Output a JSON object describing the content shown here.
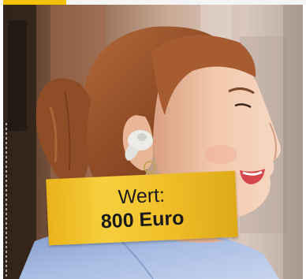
{
  "badge": {
    "label": "Wert:",
    "value": "800 Euro"
  },
  "colors": {
    "badge_gold": "#f1c02a",
    "accent_tab": "#f2c200",
    "hair": "#9a4a22",
    "skin": "#f2c4a4",
    "shirt": "#9fb5de",
    "earbud": "#e9e9e7"
  },
  "photo": {
    "subject": "woman-with-earbud"
  }
}
